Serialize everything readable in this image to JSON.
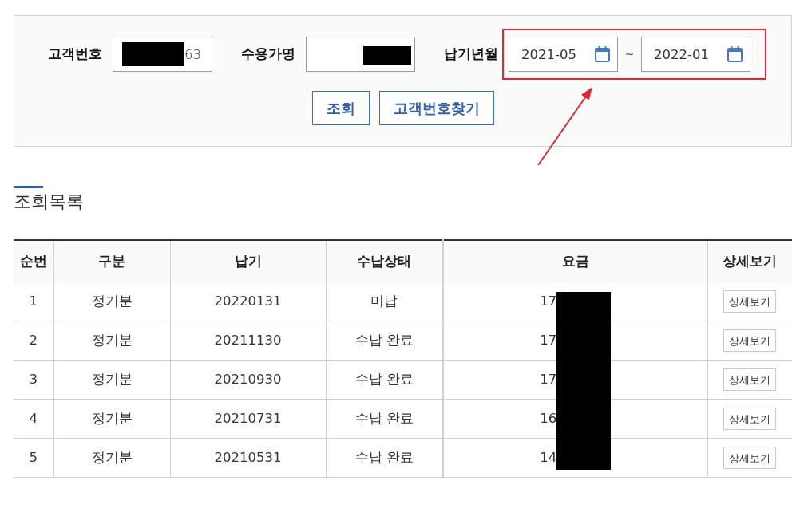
{
  "search": {
    "filters": [
      {
        "kind": "text",
        "label": "고객번호",
        "value": "63",
        "redacted": true
      },
      {
        "kind": "text",
        "label": "수용가명",
        "redacted": true
      },
      {
        "kind": "month_range",
        "label": "납기년월",
        "from": "2021-05",
        "separator": "~",
        "to": "2022-01",
        "highlighted": true
      }
    ],
    "buttons": [
      "조회",
      "고객번호찾기"
    ]
  },
  "results": {
    "title": "조회목록",
    "columns": [
      "순번",
      "구분",
      "납기",
      "수납상태",
      "요금",
      "상세보기"
    ],
    "rows": [
      {
        "no": "1",
        "category": "정기분",
        "due_date": "20220131",
        "status": "미납",
        "fee": "17",
        "detail": "상세보기"
      },
      {
        "no": "2",
        "category": "정기분",
        "due_date": "20211130",
        "status": "수납 완료",
        "fee": "17",
        "detail": "상세보기"
      },
      {
        "no": "3",
        "category": "정기분",
        "due_date": "20210930",
        "status": "수납 완료",
        "fee": "17",
        "detail": "상세보기"
      },
      {
        "no": "4",
        "category": "정기분",
        "due_date": "20210731",
        "status": "수납 완료",
        "fee": "16",
        "detail": "상세보기"
      },
      {
        "no": "5",
        "category": "정기분",
        "due_date": "20210531",
        "status": "수납 완료",
        "fee": "14",
        "detail": "상세보기"
      }
    ],
    "fee_redacted": true
  }
}
